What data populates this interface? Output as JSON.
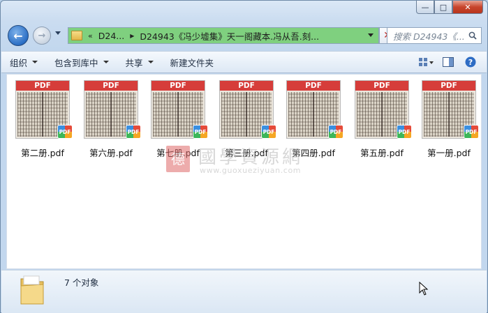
{
  "window": {
    "caption_buttons": {
      "minimize": "—",
      "maximize": "□",
      "close": "✕"
    }
  },
  "nav": {
    "back_icon": "back-arrow-icon",
    "forward_icon": "forward-arrow-icon",
    "address": {
      "chevron": "«",
      "segments": [
        "D24...",
        "D24943《冯少墟集》天一阁藏本.冯从吾.刻..."
      ],
      "accent_color": "#7fd07f"
    },
    "search_placeholder": "搜索 D24943《..."
  },
  "toolbar": {
    "items": [
      {
        "label": "组织",
        "dropdown": true
      },
      {
        "label": "包含到库中",
        "dropdown": true
      },
      {
        "label": "共享",
        "dropdown": true
      },
      {
        "label": "新建文件夹",
        "dropdown": false
      }
    ],
    "right_icons": [
      "view-options-icon",
      "preview-pane-icon",
      "help-icon"
    ]
  },
  "files": [
    {
      "name": "第二册.pdf",
      "band": "PDF",
      "badge": "PDF"
    },
    {
      "name": "第六册.pdf",
      "band": "PDF",
      "badge": "PDF"
    },
    {
      "name": "第七册.pdf",
      "band": "PDF",
      "badge": "PDF"
    },
    {
      "name": "第三册.pdf",
      "band": "PDF",
      "badge": "PDF"
    },
    {
      "name": "第四册.pdf",
      "band": "PDF",
      "badge": "PDF"
    },
    {
      "name": "第五册.pdf",
      "band": "PDF",
      "badge": "PDF"
    },
    {
      "name": "第一册.pdf",
      "band": "PDF",
      "badge": "PDF"
    }
  ],
  "watermark": {
    "seal": "德",
    "title": "國學資源網",
    "url": "www.guoxueziyuan.com"
  },
  "status": {
    "text": "7 个对象"
  }
}
